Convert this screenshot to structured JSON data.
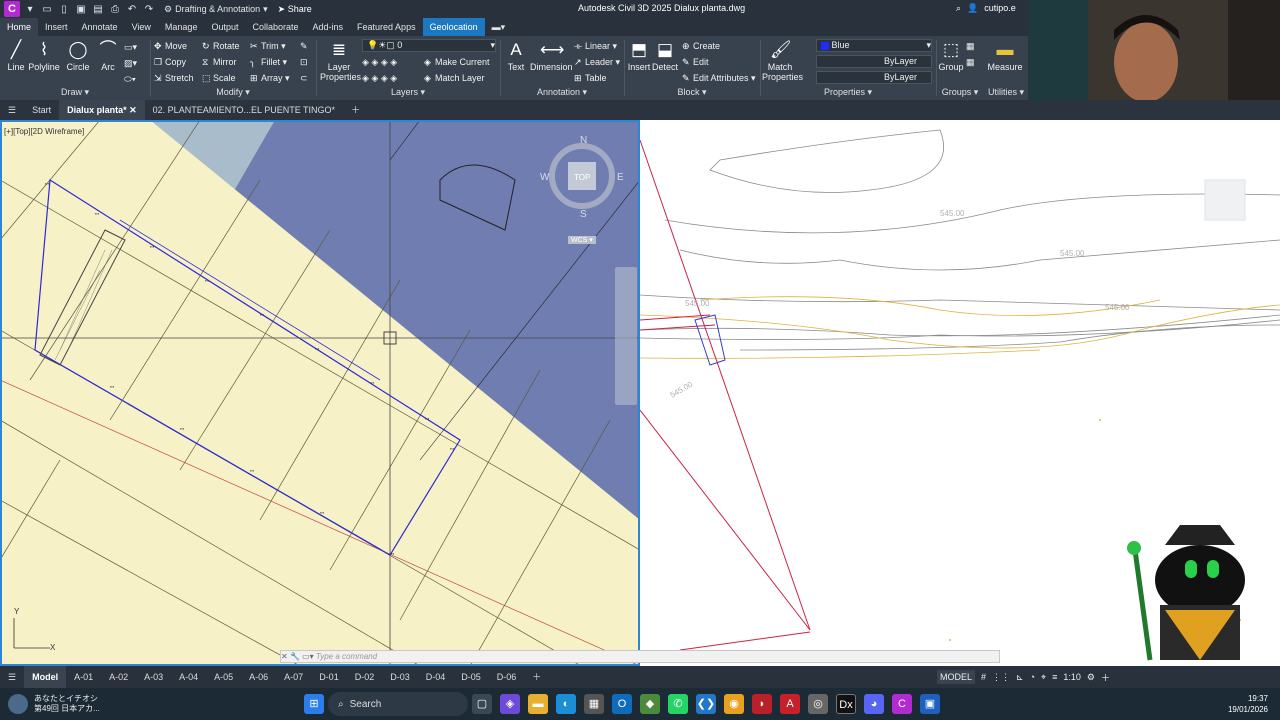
{
  "title_bar": {
    "workspace": "Drafting & Annotation",
    "share": "Share",
    "app_title": "Autodesk Civil 3D 2025   Dialux planta.dwg",
    "user": "cutipo.e"
  },
  "menu_tabs": [
    "Home",
    "Insert",
    "Annotate",
    "View",
    "Manage",
    "Output",
    "Collaborate",
    "Add-ins",
    "Featured Apps",
    "Geolocation"
  ],
  "ribbon": {
    "draw": {
      "label": "Draw",
      "line": "Line",
      "polyline": "Polyline",
      "circle": "Circle",
      "arc": "Arc"
    },
    "modify": {
      "label": "Modify",
      "move": "Move",
      "rotate": "Rotate",
      "trim": "Trim",
      "copy": "Copy",
      "mirror": "Mirror",
      "fillet": "Fillet",
      "stretch": "Stretch",
      "scale": "Scale",
      "array": "Array"
    },
    "layers": {
      "label": "Layers",
      "layer_properties": "Layer Properties",
      "layer_value": "0",
      "make_current": "Make Current",
      "match_layer": "Match Layer"
    },
    "annotation": {
      "label": "Annotation",
      "text": "Text",
      "dimension": "Dimension",
      "linear": "Linear",
      "leader": "Leader",
      "table": "Table"
    },
    "block": {
      "label": "Block",
      "insert": "Insert",
      "detect": "Detect",
      "create": "Create",
      "edit": "Edit",
      "edit_attributes": "Edit Attributes"
    },
    "properties": {
      "label": "Properties",
      "match": "Match Properties",
      "color": "Blue",
      "linetype": "ByLayer",
      "lineweight": "ByLayer"
    },
    "groups": {
      "label": "Groups",
      "group": "Group"
    },
    "utilities": {
      "label": "Utilities",
      "measure": "Measure"
    }
  },
  "doc_tabs": {
    "start": "Start",
    "active": "Dialux planta*",
    "other": "02. PLANTEAMIENTO...EL PUENTE TINGO*"
  },
  "viewport": {
    "label": "[+][Top][2D Wireframe]",
    "compass": {
      "n": "N",
      "s": "S",
      "e": "E",
      "w": "W",
      "top": "TOP",
      "wcs": "WCS"
    },
    "contours": [
      "545.00",
      "545.00",
      "545.00",
      "545.00",
      "545.00"
    ]
  },
  "command": {
    "placeholder": "Type a command"
  },
  "layout_tabs": [
    "Model",
    "A-01",
    "A-02",
    "A-03",
    "A-04",
    "A-05",
    "A-06",
    "A-07",
    "D-01",
    "D-02",
    "D-03",
    "D-04",
    "D-05",
    "D-06"
  ],
  "status": {
    "model": "MODEL",
    "scale": "1:10"
  },
  "taskbar": {
    "news_line1": "あなたとイチオシ",
    "news_line2": "第49回 日本アカ...",
    "search": "Search",
    "time": "19:37",
    "date": "19/01/2026"
  }
}
